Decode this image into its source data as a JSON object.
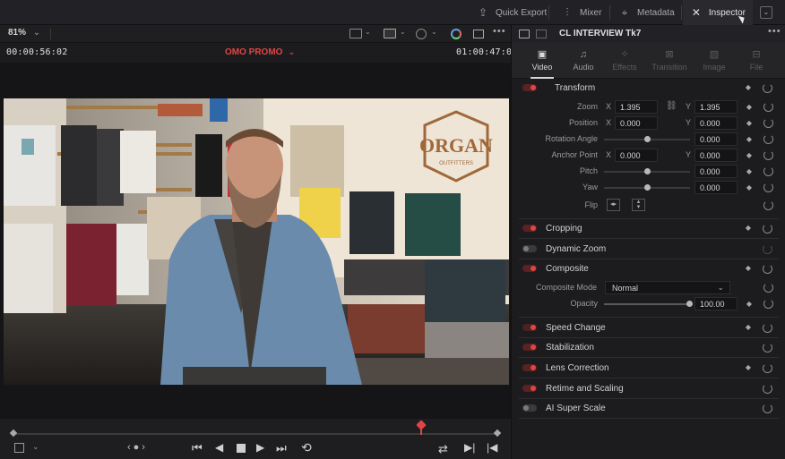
{
  "topbar": {
    "items": [
      {
        "label": "Quick Export",
        "icon": "upload-icon"
      },
      {
        "label": "Mixer",
        "icon": "sliders-icon"
      },
      {
        "label": "Metadata",
        "icon": "tag-icon"
      },
      {
        "label": "Inspector",
        "icon": "magic-wand-icon"
      }
    ]
  },
  "viewer": {
    "zoom": "81%",
    "timecode_left": "00:00:56:02",
    "timeline_name": "OMO PROMO",
    "timecode_right": "01:00:47:06",
    "sign_text": "ORGAN",
    "sign_sub": "OUTFITTERS"
  },
  "inspector": {
    "clip_title": "CL INTERVIEW Tk7",
    "tabs": [
      {
        "label": "Video",
        "icon": "film-icon",
        "active": true
      },
      {
        "label": "Audio",
        "icon": "music-note-icon",
        "active": false
      },
      {
        "label": "Effects",
        "icon": "effects-icon",
        "active": false
      },
      {
        "label": "Transition",
        "icon": "transition-icon",
        "active": false
      },
      {
        "label": "Image",
        "icon": "image-icon",
        "active": false
      },
      {
        "label": "File",
        "icon": "file-icon",
        "active": false
      }
    ],
    "transform": {
      "title": "Transform",
      "zoom_label": "Zoom",
      "zoom_x": "1.395",
      "zoom_y": "1.395",
      "position_label": "Position",
      "position_x": "0.000",
      "position_y": "0.000",
      "rotation_label": "Rotation Angle",
      "rotation": "0.000",
      "anchor_label": "Anchor Point",
      "anchor_x": "0.000",
      "anchor_y": "0.000",
      "pitch_label": "Pitch",
      "pitch": "0.000",
      "yaw_label": "Yaw",
      "yaw": "0.000",
      "flip_label": "Flip",
      "x_axis": "X",
      "y_axis": "Y"
    },
    "sections": {
      "cropping": "Cropping",
      "dynamic_zoom": "Dynamic Zoom",
      "composite": "Composite",
      "speed_change": "Speed Change",
      "stabilization": "Stabilization",
      "lens_correction": "Lens Correction",
      "retime": "Retime and Scaling",
      "ai_super_scale": "AI Super Scale"
    },
    "composite": {
      "mode_label": "Composite Mode",
      "mode_value": "Normal",
      "opacity_label": "Opacity",
      "opacity_value": "100.00"
    }
  },
  "colors": {
    "accent": "#e04545",
    "panel": "#1c1c1f"
  }
}
